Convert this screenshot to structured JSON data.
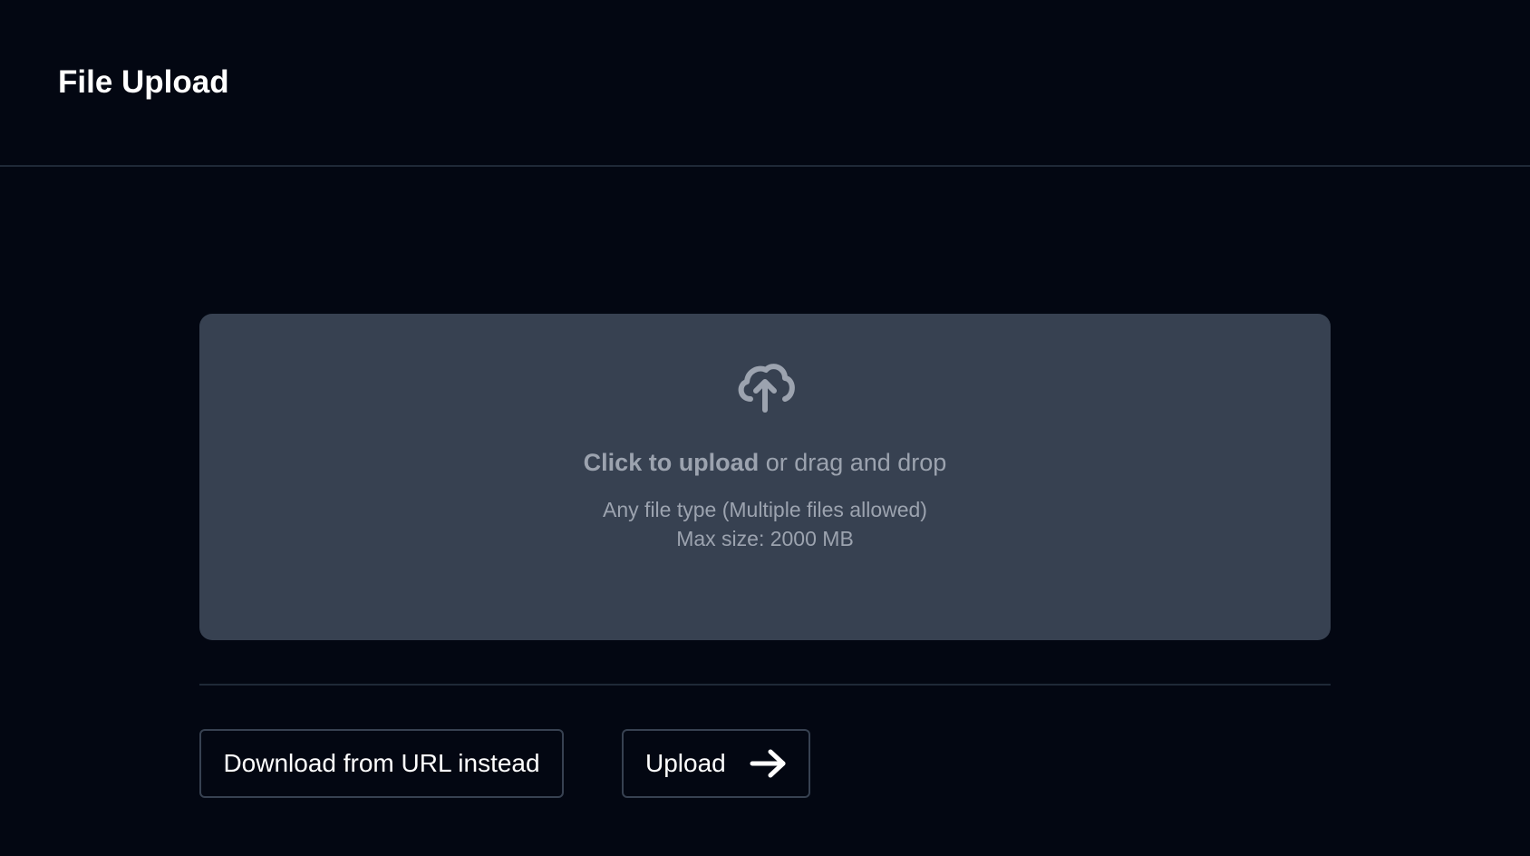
{
  "header": {
    "title": "File Upload"
  },
  "dropzone": {
    "icon": "cloud-upload-icon",
    "cta_strong": "Click to upload",
    "cta_rest": " or drag and drop",
    "hint_types": "Any file type (Multiple files allowed)",
    "hint_size": "Max size: 2000 MB"
  },
  "actions": {
    "url_label": "Download from URL instead",
    "upload_label": "Upload",
    "upload_icon": "arrow-right-icon"
  },
  "colors": {
    "background": "#030712",
    "dropzone": "#374151",
    "muted_text": "#9ca3af",
    "border": "#1f2937"
  }
}
